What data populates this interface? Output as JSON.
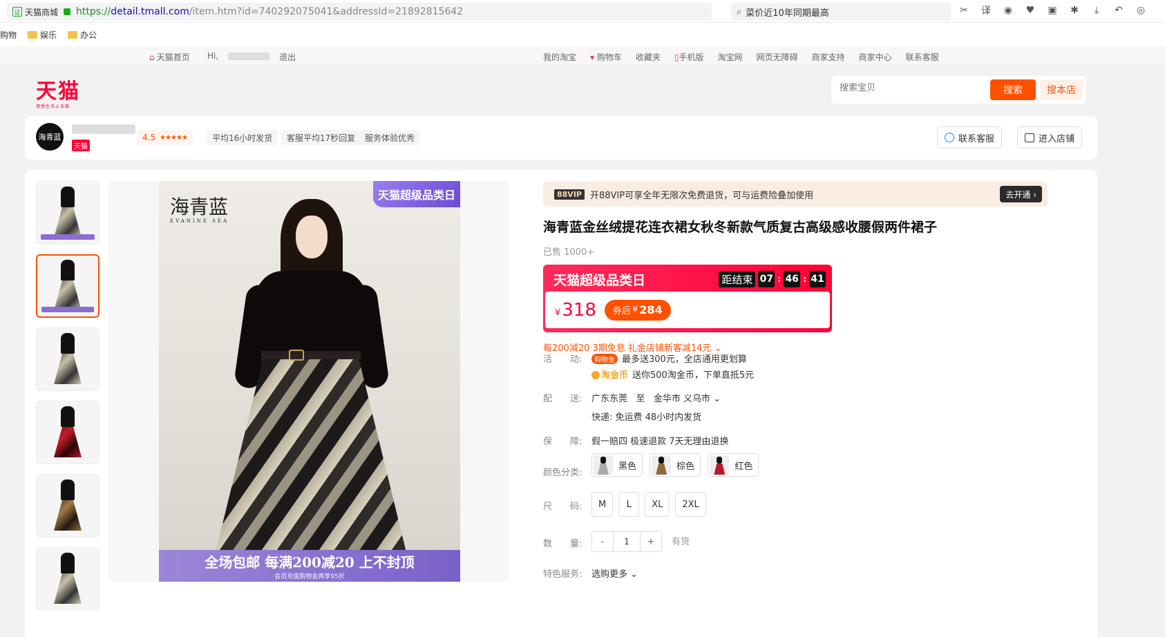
{
  "browser": {
    "site_name": "天猫商城",
    "url_protocol": "https://",
    "url_host": "detail.tmall.com",
    "url_rest": "/item.htm?id=740292075041&addressId=21892815642",
    "search_text": "菜价近10年同期最高"
  },
  "bookmarks": [
    {
      "label": "购物"
    },
    {
      "label": "娱乐"
    },
    {
      "label": "办公"
    }
  ],
  "site_nav": {
    "home": "天猫首页",
    "hi": "Hi,",
    "logout": "退出",
    "links": [
      "我的淘宝",
      "购物车",
      "收藏夹",
      "手机版",
      "淘宝网",
      "网页无障碍",
      "商家支持",
      "商家中心",
      "联系客服"
    ]
  },
  "header": {
    "logo": "天猫",
    "logo_sub": "理想生活上天猫",
    "search_placeholder": "搜索宝贝",
    "search_button": "搜索",
    "search_store_button": "搜本店"
  },
  "store": {
    "logo_text": "海青蓝",
    "tag": "天猫",
    "rating": "4.5",
    "pills": [
      "平均16小时发货",
      "客服平均17秒回复",
      "服务体验优秀"
    ],
    "contact_button": "联系客服",
    "enter_button": "进入店铺"
  },
  "gallery": {
    "brand_text": "海青蓝",
    "brand_sub": "EVANINE SEA",
    "promo_tag": "天猫超级品类日",
    "banner_main": "全场包邮 每满200减20 上不封顶",
    "banner_sub": "会员充值购物金再享95折"
  },
  "product": {
    "vip_badge": "88VIP",
    "vip_text": "开88VIP可享全年无限次免费退货，可与运费险叠加使用",
    "vip_button": "去开通 ›",
    "title": "海青蓝金丝绒提花连衣裙女秋冬新款气质复古高级感收腰假两件裙子",
    "sold": "已售 1000+",
    "promo_label": "天猫超级品类日",
    "countdown_label": "距结束",
    "countdown": [
      "07",
      "46",
      "41"
    ],
    "currency": "¥",
    "price": "318",
    "coupon_label": "券后",
    "coupon_price": "284",
    "promotions": "每200减20 3期免息 礼金店铺新客减14元 ⌄",
    "activity_label": "活　　动:",
    "activity_tag": "购物金",
    "activity_line1": "最多送300元，全店通用更划算",
    "activity_coin_label": "淘金币",
    "activity_line2": "送你500淘金币，下单直抵5元",
    "delivery_label": "配　　送:",
    "delivery_from": "广东东莞",
    "delivery_to_word": "至",
    "delivery_to": "金华市 义乌市 ⌄",
    "delivery_line2": "快递: 免运费   48小时内发货",
    "guarantee_label": "保　　障:",
    "guarantee": "假一赔四 极速退款 7天无理由退换",
    "color_label": "颜色分类:",
    "colors": [
      "黑色",
      "棕色",
      "红色"
    ],
    "size_label": "尺　　码:",
    "sizes": [
      "M",
      "L",
      "XL",
      "2XL"
    ],
    "qty_label": "数　　量:",
    "qty_minus": "-",
    "qty_value": "1",
    "qty_plus": "+",
    "stock": "有货",
    "service_label": "特色服务:",
    "service_value": "选购更多 ⌄"
  }
}
